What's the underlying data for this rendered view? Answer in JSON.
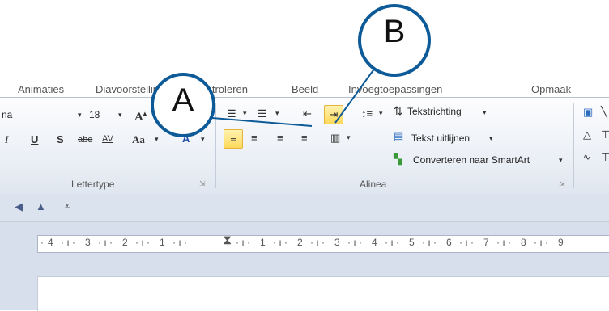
{
  "tabs": [
    "Animaties",
    "Diavoorstelling",
    "Controleren",
    "Beeld",
    "Invoegtoepassingen",
    "Opmaak"
  ],
  "font_group": {
    "font_name": "na",
    "font_size": "18",
    "label": "Lettertype",
    "buttons": [
      "I",
      "U",
      "S",
      "abe",
      "AV",
      "Aa",
      "A"
    ]
  },
  "paragraph_group": {
    "label": "Alinea",
    "text_direction": "Tekstrichting",
    "align_text": "Tekst uitlijnen",
    "convert_smartart": "Converteren naar SmartArt",
    "highlighted_button": "increase-indent"
  },
  "ruler": {
    "left_numbers": [
      "4",
      "3",
      "2",
      "1"
    ],
    "right_numbers": [
      "1",
      "2",
      "3",
      "4",
      "5",
      "6",
      "7",
      "8",
      "9"
    ]
  },
  "callouts": {
    "a": "A",
    "b": "B"
  },
  "colors": {
    "callout_border": "#0d5a98",
    "highlight": "#ffd95a"
  }
}
